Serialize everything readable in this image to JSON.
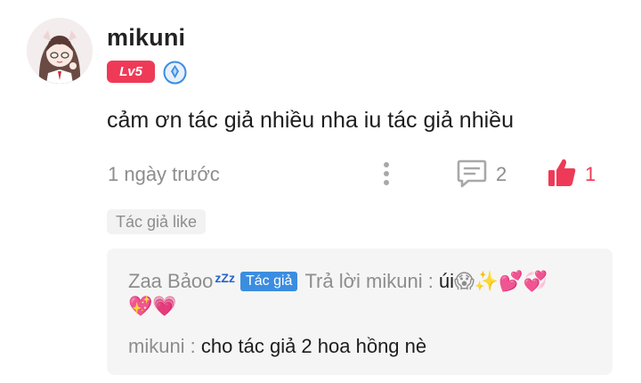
{
  "comment": {
    "username": "mikuni",
    "level_badge": "Lv5",
    "text": "cảm ơn tác giả nhiều nha iu tác giả nhiều",
    "time": "1 ngày trước",
    "reply_count": "2",
    "like_count": "1",
    "author_like_tag": "Tác giả like"
  },
  "replies": {
    "first": {
      "name": "Zaa Bảoo",
      "name_suffix": "ᵶᵶz",
      "author_tag": "Tác giả",
      "reply_prefix": "Trả lời mikuni :",
      "text": "úi",
      "emojis_line1": "😱✨💕💞",
      "emojis_line2": "💖💗"
    },
    "second": {
      "name": "mikuni :",
      "text": "cho tác giả 2 hoa hồng nè"
    }
  },
  "colors": {
    "accent_red": "#ee3a57",
    "author_tag_blue": "#3b8de0",
    "muted_text": "#8d8d8d"
  },
  "icons": [
    "avatar-image",
    "verified-icon",
    "more-icon",
    "reply-icon",
    "like-icon"
  ]
}
